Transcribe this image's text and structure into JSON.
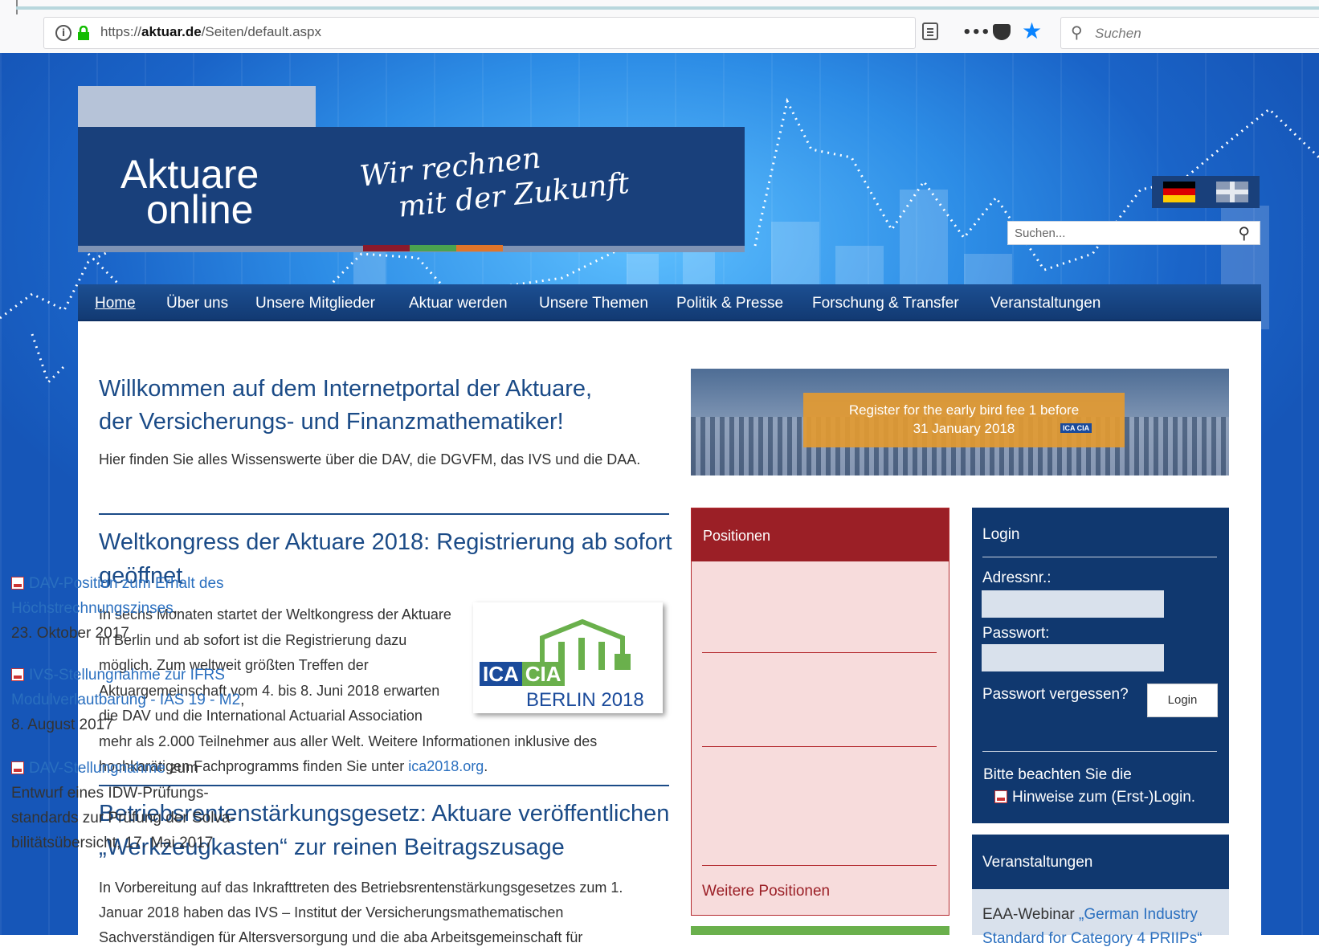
{
  "browser": {
    "url_prefix": "https://",
    "url_domain": "aktuar.de",
    "url_path": "/Seiten/default.aspx",
    "search_placeholder": "Suchen",
    "accent_color": "#0a84ff"
  },
  "header": {
    "brand_line1": "Aktuare",
    "brand_line2": "online",
    "slogan_line1": "Wir rechnen",
    "slogan_line2": "mit der Zukunft",
    "stripe_colors": [
      "#8b1a2b",
      "#4aa34f",
      "#e0752a"
    ],
    "search_placeholder": "Suchen..."
  },
  "nav": {
    "items": [
      "Home",
      "Über uns",
      "Unsere Mitglieder",
      "Aktuar werden",
      "Unsere Themen",
      "Politik & Presse",
      "Forschung & Transfer",
      "Veranstaltungen"
    ]
  },
  "main": {
    "welcome_line1": "Willkommen auf dem Internetportal der Aktuare,",
    "welcome_line2": "der Versicherungs- und Finanzmathematiker!",
    "intro": "Hier finden Sie alles Wissenswerte über die DAV, die DGVFM, das IVS und die DAA.",
    "news1_title": "Weltkongress der Aktuare 2018: Registrierung ab sofort geöffnet",
    "news1_body": "In sechs Monaten startet der Weltkongress der Aktuare in Berlin und ab sofort ist die Registrierung dazu möglich. Zum weltweit größten Treffen der Aktuargemeinschaft vom 4. bis 8. Juni 2018 erwarten die DAV und die International Actuarial Association mehr als 2.000 Teilnehmer aus aller Welt. Weitere Informationen inklusive des hochkarätigen Fachprogramms finden Sie unter ",
    "news1_link": "ica2018.org",
    "news1_end": ".",
    "ica_logo": {
      "ica": "ICA",
      "cia": "CIA",
      "city": "BERLIN 2018"
    },
    "news2_title": "Betriebsrentenstärkungsgesetz: Aktuare veröffentlichen „Werkzeugkasten“ zur reinen Beitragszusage",
    "news2_body": "In Vorbereitung auf das Inkrafttreten des Betriebsrentenstärkungsgesetzes zum 1. Januar 2018 haben das IVS – Institut der Versicherungsmathematischen Sachverständigen für Altersversorgung und die aba Arbeitsgemeinschaft für"
  },
  "banner": {
    "line1": "Register for the early bird fee 1 before",
    "line2": "31 January 2018",
    "badge": "ICA CIA"
  },
  "positionen": {
    "title": "Positionen",
    "items": [
      {
        "link": "DAV-Position zum Erhalt des Höchstrechnungszinses",
        "text": ",\n23. Oktober 2017"
      },
      {
        "link": "IVS-Stellungnahme zur IFRS Modulverlautbarung - IAS 19 - M2",
        "text": ", 8. August 2017"
      },
      {
        "link": "DAV-Stellungnahme",
        "text": " zum Entwurf eines IDW-Prüfungs-standards zur Prüfung der Solva-bilitätsübersicht, 17. Mai 2017"
      }
    ],
    "more": "Weitere Positionen"
  },
  "login": {
    "title": "Login",
    "address_label": "Adressnr.:",
    "password_label": "Passwort:",
    "forgot": "Passwort vergessen?",
    "button": "Login",
    "note_line1": "Bitte beachten Sie die",
    "note_link": "Hinweise zum (Erst-)Login."
  },
  "events": {
    "title": "Veranstaltungen",
    "text_prefix": "EAA-Webinar ",
    "text_link": "„German Industry Standard for Category 4 PRIIPs“"
  }
}
